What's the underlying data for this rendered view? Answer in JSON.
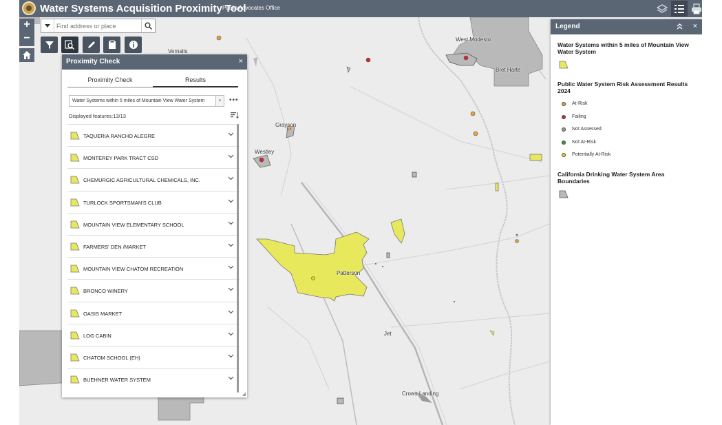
{
  "header": {
    "title": "Water Systems Acquisition Proximity Tool",
    "subtitle": "Public Advocates Office",
    "icons": [
      "logo-seal-icon",
      "layers-icon",
      "legend-list-icon",
      "print-icon"
    ]
  },
  "search": {
    "placeholder": "Find address or place"
  },
  "map_tools": {
    "zoom_in": "+",
    "zoom_out": "−",
    "icons": [
      "home-icon",
      "filter-icon",
      "proximity-search-icon",
      "measure-pencil-icon",
      "clipboard-icon",
      "info-icon"
    ]
  },
  "map_labels": [
    "Vernalis",
    "West Modesto",
    "Bret Harte",
    "Grayson",
    "Westley",
    "Patterson",
    "Jet",
    "Crows Landing"
  ],
  "proximity_panel": {
    "title": "Proximity Check",
    "close": "×",
    "tabs": [
      "Proximity Check",
      "Results"
    ],
    "active_tab": "Results",
    "layer_select": "Water Systems within 5 miles of Mountain View Water System",
    "more": "•••",
    "displayed_features": "Displayed features:13/13",
    "results": [
      "TAQUERIA RANCHO ALEGRE",
      "MONTEREY PARK TRACT CSD",
      "CHEMURGIC AGRICULTURAL CHEMICALS, INC.",
      "TURLOCK SPORTSMAN'S CLUB",
      "MOUNTAIN VIEW ELEMENTARY SCHOOL",
      "FARMERS' DEN /MARKET",
      "MOUNTAIN VIEW CHATOM RECREATION",
      "BRONCO WINERY",
      "OASIS MARKET",
      "LOG CABIN",
      "CHATOM SCHOOL (EH)",
      "BUEHNER WATER SYSTEM"
    ]
  },
  "legend": {
    "title": "Legend",
    "close": "×",
    "section1_title": "Water Systems within 5 miles of Mountain View Water System",
    "section2_title": "Public Water System Risk Assessment Results 2024",
    "risk_items": [
      {
        "label": "At-Risk",
        "color": "#e8a33a"
      },
      {
        "label": "Failing",
        "color": "#d9232a"
      },
      {
        "label": "Not Assessed",
        "color": "#9a9a9a"
      },
      {
        "label": "Not At-Risk",
        "color": "#2e9e34"
      },
      {
        "label": "Potentially At-Risk",
        "color": "#f2d600"
      }
    ],
    "section3_title": "California Drinking Water System Area Boundaries"
  },
  "colors": {
    "header": "#5b6675",
    "highlight_polygon": "#e8e85c",
    "boundary_polygon": "#b9b9b9"
  }
}
